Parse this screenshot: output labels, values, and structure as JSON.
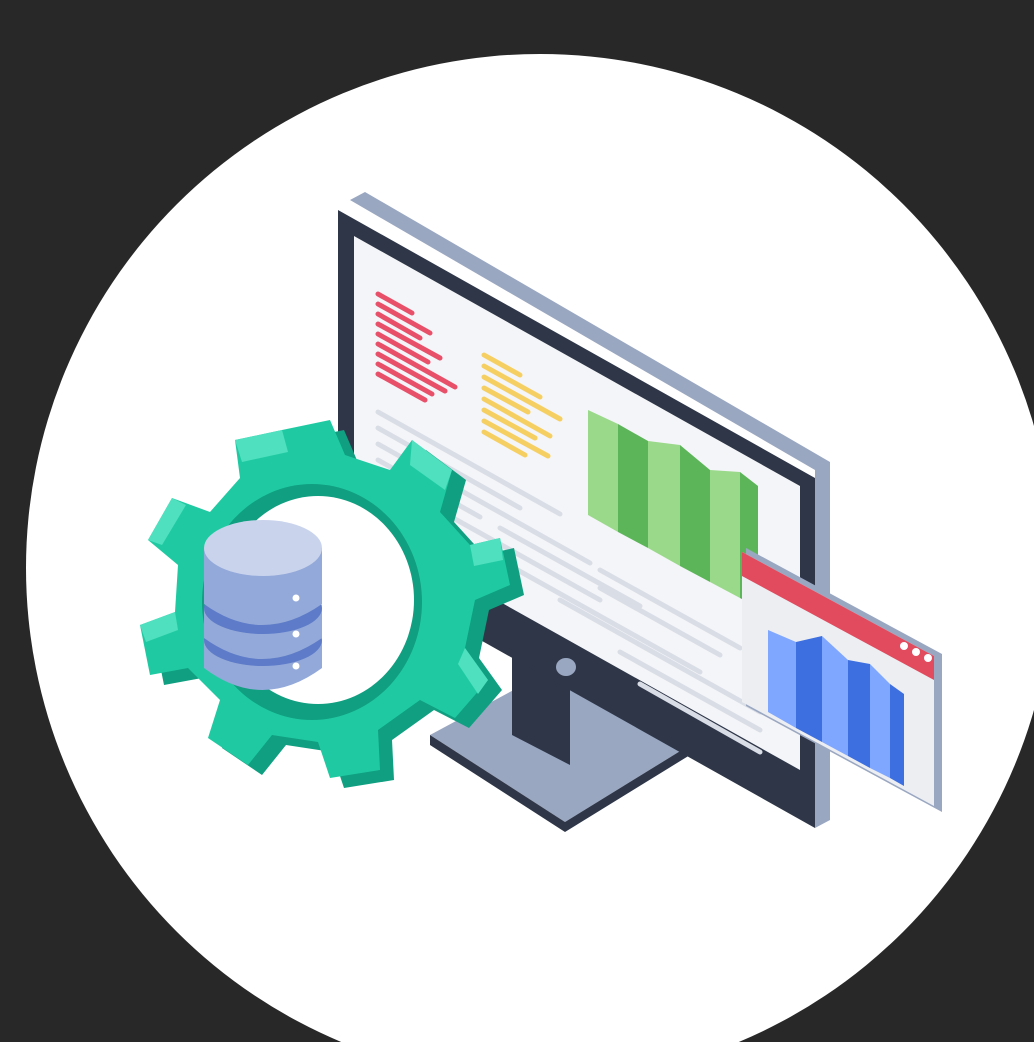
{
  "colors": {
    "background": "#282828",
    "circle": "#ffffff",
    "gear_main": "#1fcaa2",
    "gear_light": "#4fe0bf",
    "gear_dark": "#109f80",
    "database_top": "#c9d3ec",
    "database_side": "#93a9d9",
    "database_band": "#5d7bc8",
    "monitor_bezel": "#2e3648",
    "monitor_back": "#9aa7c1",
    "screen": "#f4f5f8",
    "code_red": "#e8506a",
    "code_yellow": "#f6cf63",
    "chart_green_light": "#9ad98a",
    "chart_green_dark": "#5db55a",
    "text_lines": "#d9dde6",
    "popup_header": "#e24a5e",
    "popup_body": "#eceef2",
    "popup_bars_light": "#7fa7ff",
    "popup_bars_dark": "#3d6fe0"
  },
  "icons": {
    "gear": "gear-icon",
    "database": "database-icon",
    "monitor": "monitor-icon",
    "window": "chart-window-icon"
  }
}
